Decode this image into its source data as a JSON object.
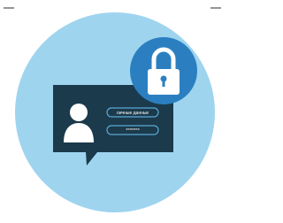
{
  "illustration": {
    "login_field_text": "личные данные",
    "password_field_text": "********",
    "colors": {
      "circle": "#9fd4ef",
      "panel": "#1b3a4b",
      "field_outline": "#5aa9d6",
      "lock_badge": "#2b7fc0",
      "icon_white": "#ffffff"
    }
  }
}
